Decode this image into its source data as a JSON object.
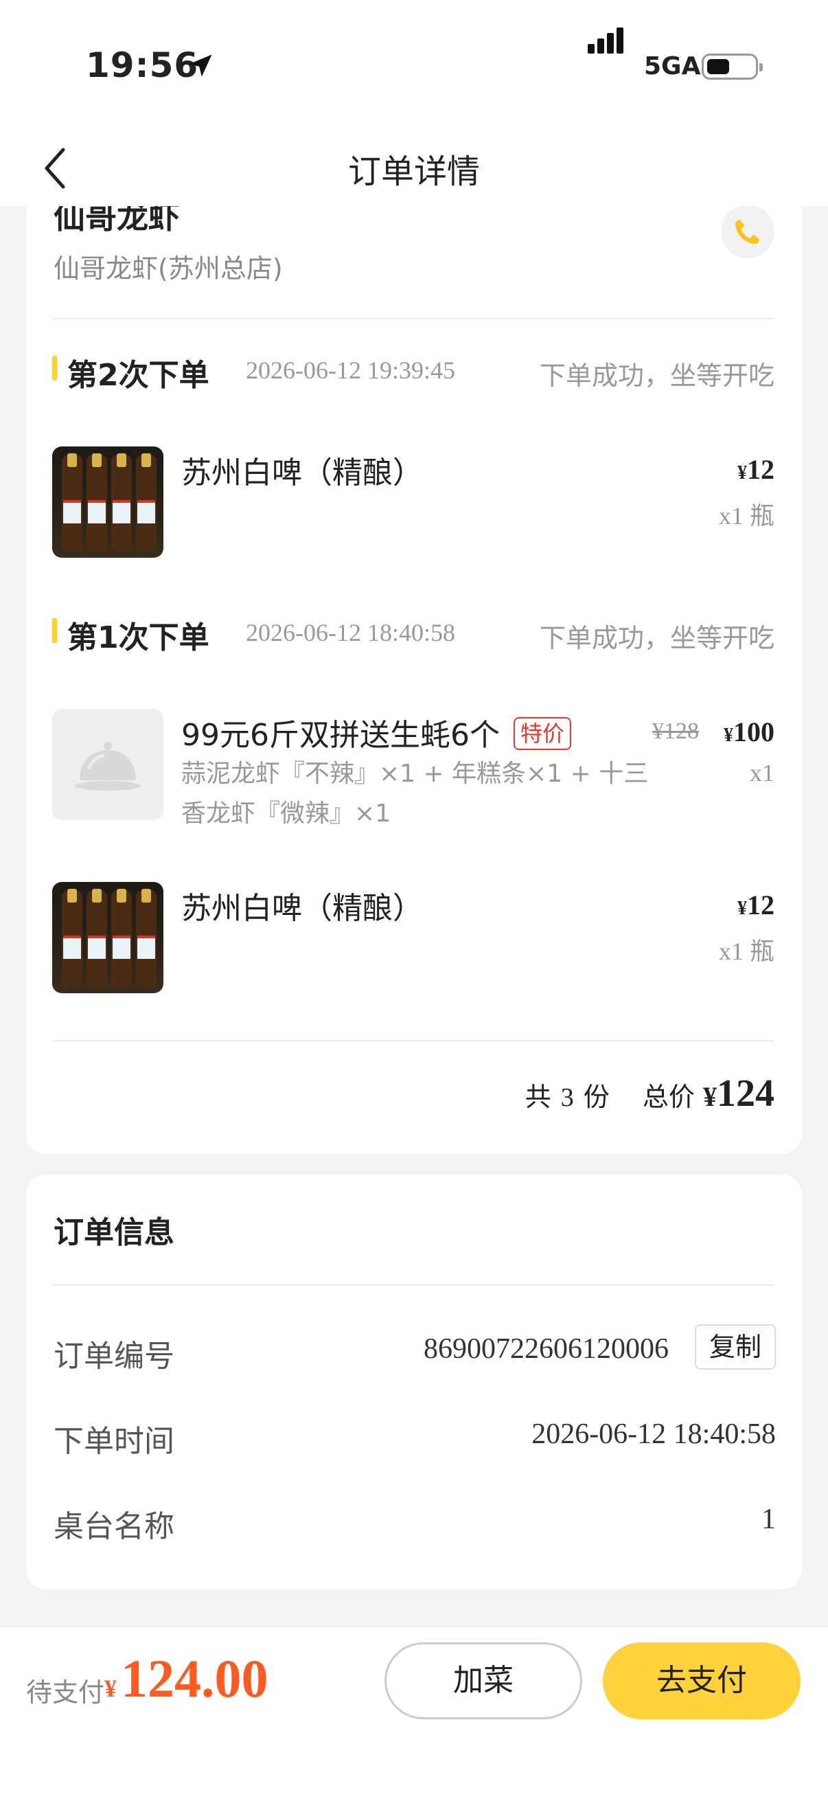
{
  "status_bar": {
    "time": "19:56",
    "network": "5GA",
    "battery_level": 0.45
  },
  "nav": {
    "title": "订单详情"
  },
  "shop": {
    "name": "仙哥龙虾",
    "branch": "仙哥龙虾(苏州总店)"
  },
  "rounds": [
    {
      "label": "第2次下单",
      "time": "2026-06-12 19:39:45",
      "status": "下单成功，坐等开吃",
      "items": [
        {
          "name": "苏州白啤（精酿）",
          "price_symbol": "¥",
          "price": "12",
          "qty": "x1 瓶",
          "thumb": "beer-image"
        }
      ]
    },
    {
      "label": "第1次下单",
      "time": "2026-06-12 18:40:58",
      "status": "下单成功，坐等开吃",
      "items": [
        {
          "name": "99元6斤双拼送生蚝6个",
          "tag": "特价",
          "old_price": "¥128",
          "price_symbol": "¥",
          "price": "100",
          "qty": "x1",
          "desc": "蒜泥龙虾『不辣』×1 + 年糕条×1 + 十三香龙虾『微辣』×1",
          "thumb": "dish-placeholder-icon"
        },
        {
          "name": "苏州白啤（精酿）",
          "price_symbol": "¥",
          "price": "12",
          "qty": "x1 瓶",
          "thumb": "beer-image"
        }
      ]
    }
  ],
  "summary": {
    "prefix": "共",
    "count": "3",
    "unit": "份",
    "total_label": "总价",
    "yen": "¥",
    "total": "124"
  },
  "order_info": {
    "title": "订单信息",
    "order_no_label": "订单编号",
    "order_no": "86900722606120006",
    "copy_label": "复制",
    "order_time_label": "下单时间",
    "order_time": "2026-06-12 18:40:58",
    "table_label": "桌台名称",
    "table": "1"
  },
  "bottom": {
    "pay_label": "待支付",
    "yen": "¥",
    "amount": "124.00",
    "add_label": "加菜",
    "pay_button": "去支付"
  },
  "colors": {
    "accent": "#ffd23c",
    "price_red": "#ff5a1f",
    "special_tag": "#e8372c"
  }
}
